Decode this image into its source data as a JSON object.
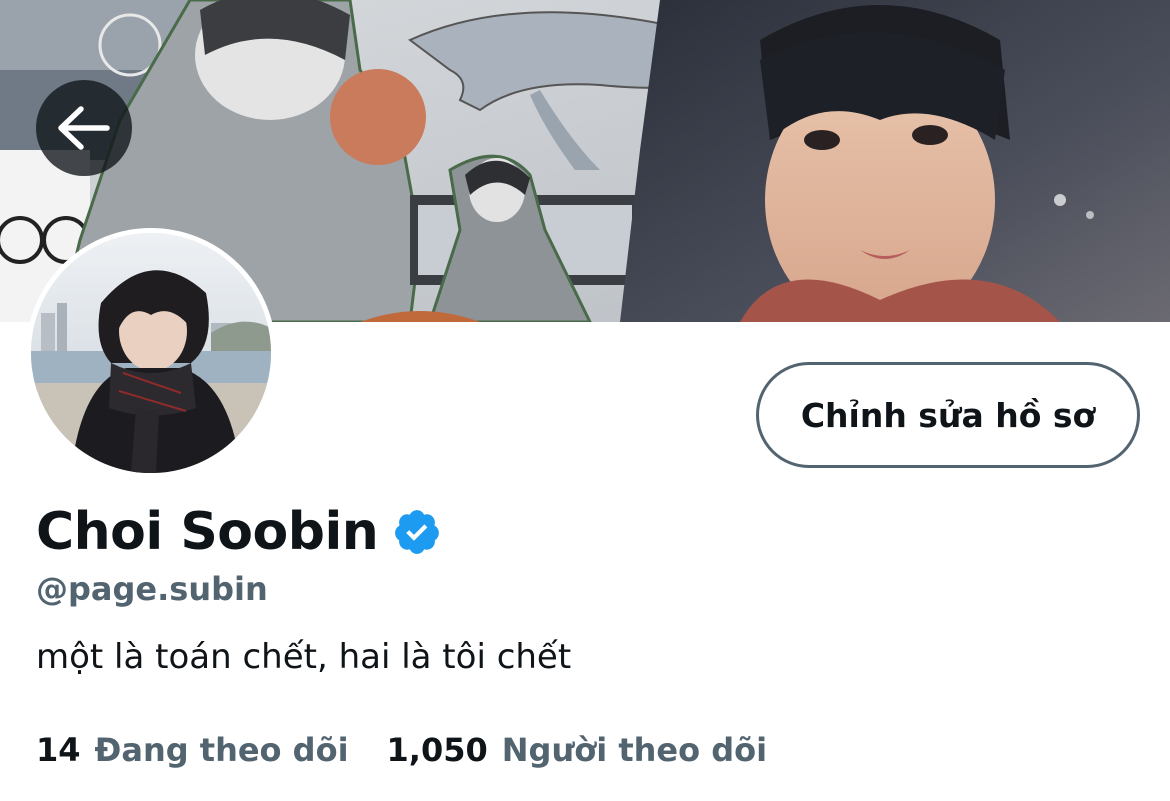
{
  "profile": {
    "display_name": "Choi Soobin",
    "handle": "@page.subin",
    "bio": "một là toán chết, hai là tôi chết",
    "verified": true
  },
  "actions": {
    "edit_profile_label": "Chỉnh sửa hồ sơ"
  },
  "stats": {
    "following_count": "14",
    "following_label": "Đang theo dõi",
    "followers_count": "1,050",
    "followers_label": "Người theo dõi"
  },
  "colors": {
    "text_primary": "#0f1419",
    "text_secondary": "#536471",
    "verified_blue": "#1d9bf0",
    "button_border": "#536471"
  },
  "icons": {
    "back": "arrow-left-icon",
    "verified": "verified-badge-icon"
  }
}
